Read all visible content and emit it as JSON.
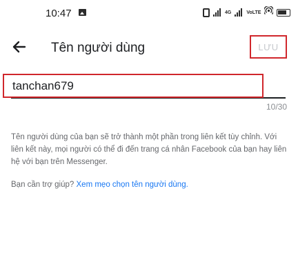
{
  "status_bar": {
    "time": "10:47",
    "network_label": "4G",
    "network_label_2": "4G",
    "volte_label": "VoLTE"
  },
  "header": {
    "title": "Tên người dùng",
    "save_label": "LƯU"
  },
  "username_field": {
    "value": "tanchan679",
    "counter": "10/30"
  },
  "description": "Tên người dùng của bạn sẽ trở thành một phần trong liên kết tùy chỉnh. Với liên kết này, mọi người có thể đi đến trang cá nhân Facebook của bạn hay liên hệ với bạn trên Messenger.",
  "help": {
    "prompt": "Bạn cần trợ giúp? ",
    "link_text": "Xem mẹo chọn tên người dùng."
  },
  "colors": {
    "highlight_border": "#d0262b",
    "link": "#1877f2",
    "muted_text": "#65676b",
    "disabled_text": "#c6c9cd"
  },
  "icons": {
    "back": "arrow-left-icon",
    "gallery": "image-icon",
    "vibrate": "vibrate-icon",
    "signal": "signal-icon",
    "hotspot": "hotspot-icon",
    "battery": "battery-icon"
  }
}
